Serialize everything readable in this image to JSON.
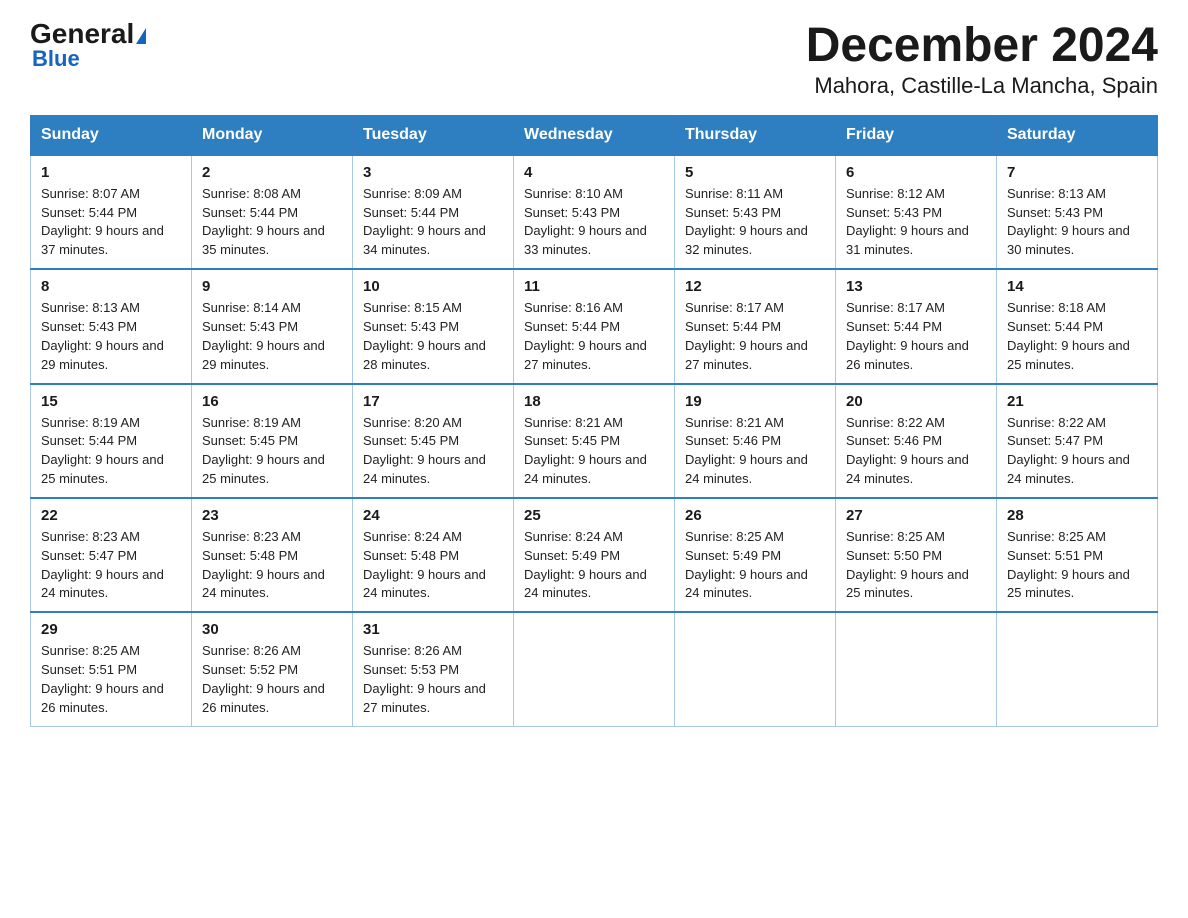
{
  "header": {
    "logo_general": "General",
    "logo_blue": "Blue",
    "title": "December 2024",
    "subtitle": "Mahora, Castille-La Mancha, Spain"
  },
  "days_of_week": [
    "Sunday",
    "Monday",
    "Tuesday",
    "Wednesday",
    "Thursday",
    "Friday",
    "Saturday"
  ],
  "weeks": [
    [
      {
        "day": 1,
        "sunrise": "8:07 AM",
        "sunset": "5:44 PM",
        "daylight": "9 hours and 37 minutes."
      },
      {
        "day": 2,
        "sunrise": "8:08 AM",
        "sunset": "5:44 PM",
        "daylight": "9 hours and 35 minutes."
      },
      {
        "day": 3,
        "sunrise": "8:09 AM",
        "sunset": "5:44 PM",
        "daylight": "9 hours and 34 minutes."
      },
      {
        "day": 4,
        "sunrise": "8:10 AM",
        "sunset": "5:43 PM",
        "daylight": "9 hours and 33 minutes."
      },
      {
        "day": 5,
        "sunrise": "8:11 AM",
        "sunset": "5:43 PM",
        "daylight": "9 hours and 32 minutes."
      },
      {
        "day": 6,
        "sunrise": "8:12 AM",
        "sunset": "5:43 PM",
        "daylight": "9 hours and 31 minutes."
      },
      {
        "day": 7,
        "sunrise": "8:13 AM",
        "sunset": "5:43 PM",
        "daylight": "9 hours and 30 minutes."
      }
    ],
    [
      {
        "day": 8,
        "sunrise": "8:13 AM",
        "sunset": "5:43 PM",
        "daylight": "9 hours and 29 minutes."
      },
      {
        "day": 9,
        "sunrise": "8:14 AM",
        "sunset": "5:43 PM",
        "daylight": "9 hours and 29 minutes."
      },
      {
        "day": 10,
        "sunrise": "8:15 AM",
        "sunset": "5:43 PM",
        "daylight": "9 hours and 28 minutes."
      },
      {
        "day": 11,
        "sunrise": "8:16 AM",
        "sunset": "5:44 PM",
        "daylight": "9 hours and 27 minutes."
      },
      {
        "day": 12,
        "sunrise": "8:17 AM",
        "sunset": "5:44 PM",
        "daylight": "9 hours and 27 minutes."
      },
      {
        "day": 13,
        "sunrise": "8:17 AM",
        "sunset": "5:44 PM",
        "daylight": "9 hours and 26 minutes."
      },
      {
        "day": 14,
        "sunrise": "8:18 AM",
        "sunset": "5:44 PM",
        "daylight": "9 hours and 25 minutes."
      }
    ],
    [
      {
        "day": 15,
        "sunrise": "8:19 AM",
        "sunset": "5:44 PM",
        "daylight": "9 hours and 25 minutes."
      },
      {
        "day": 16,
        "sunrise": "8:19 AM",
        "sunset": "5:45 PM",
        "daylight": "9 hours and 25 minutes."
      },
      {
        "day": 17,
        "sunrise": "8:20 AM",
        "sunset": "5:45 PM",
        "daylight": "9 hours and 24 minutes."
      },
      {
        "day": 18,
        "sunrise": "8:21 AM",
        "sunset": "5:45 PM",
        "daylight": "9 hours and 24 minutes."
      },
      {
        "day": 19,
        "sunrise": "8:21 AM",
        "sunset": "5:46 PM",
        "daylight": "9 hours and 24 minutes."
      },
      {
        "day": 20,
        "sunrise": "8:22 AM",
        "sunset": "5:46 PM",
        "daylight": "9 hours and 24 minutes."
      },
      {
        "day": 21,
        "sunrise": "8:22 AM",
        "sunset": "5:47 PM",
        "daylight": "9 hours and 24 minutes."
      }
    ],
    [
      {
        "day": 22,
        "sunrise": "8:23 AM",
        "sunset": "5:47 PM",
        "daylight": "9 hours and 24 minutes."
      },
      {
        "day": 23,
        "sunrise": "8:23 AM",
        "sunset": "5:48 PM",
        "daylight": "9 hours and 24 minutes."
      },
      {
        "day": 24,
        "sunrise": "8:24 AM",
        "sunset": "5:48 PM",
        "daylight": "9 hours and 24 minutes."
      },
      {
        "day": 25,
        "sunrise": "8:24 AM",
        "sunset": "5:49 PM",
        "daylight": "9 hours and 24 minutes."
      },
      {
        "day": 26,
        "sunrise": "8:25 AM",
        "sunset": "5:49 PM",
        "daylight": "9 hours and 24 minutes."
      },
      {
        "day": 27,
        "sunrise": "8:25 AM",
        "sunset": "5:50 PM",
        "daylight": "9 hours and 25 minutes."
      },
      {
        "day": 28,
        "sunrise": "8:25 AM",
        "sunset": "5:51 PM",
        "daylight": "9 hours and 25 minutes."
      }
    ],
    [
      {
        "day": 29,
        "sunrise": "8:25 AM",
        "sunset": "5:51 PM",
        "daylight": "9 hours and 26 minutes."
      },
      {
        "day": 30,
        "sunrise": "8:26 AM",
        "sunset": "5:52 PM",
        "daylight": "9 hours and 26 minutes."
      },
      {
        "day": 31,
        "sunrise": "8:26 AM",
        "sunset": "5:53 PM",
        "daylight": "9 hours and 27 minutes."
      },
      null,
      null,
      null,
      null
    ]
  ]
}
